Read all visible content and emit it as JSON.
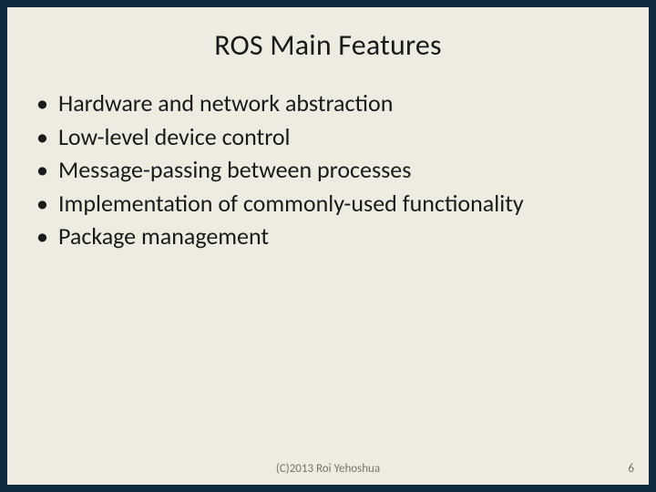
{
  "slide": {
    "title": "ROS Main Features",
    "bullets": [
      "Hardware and network abstraction",
      "Low-level device control",
      "Message-passing between processes",
      "Implementation of commonly-used functionality",
      "Package management"
    ],
    "copyright": "(C)2013 Roi Yehoshua",
    "page_number": "6"
  }
}
